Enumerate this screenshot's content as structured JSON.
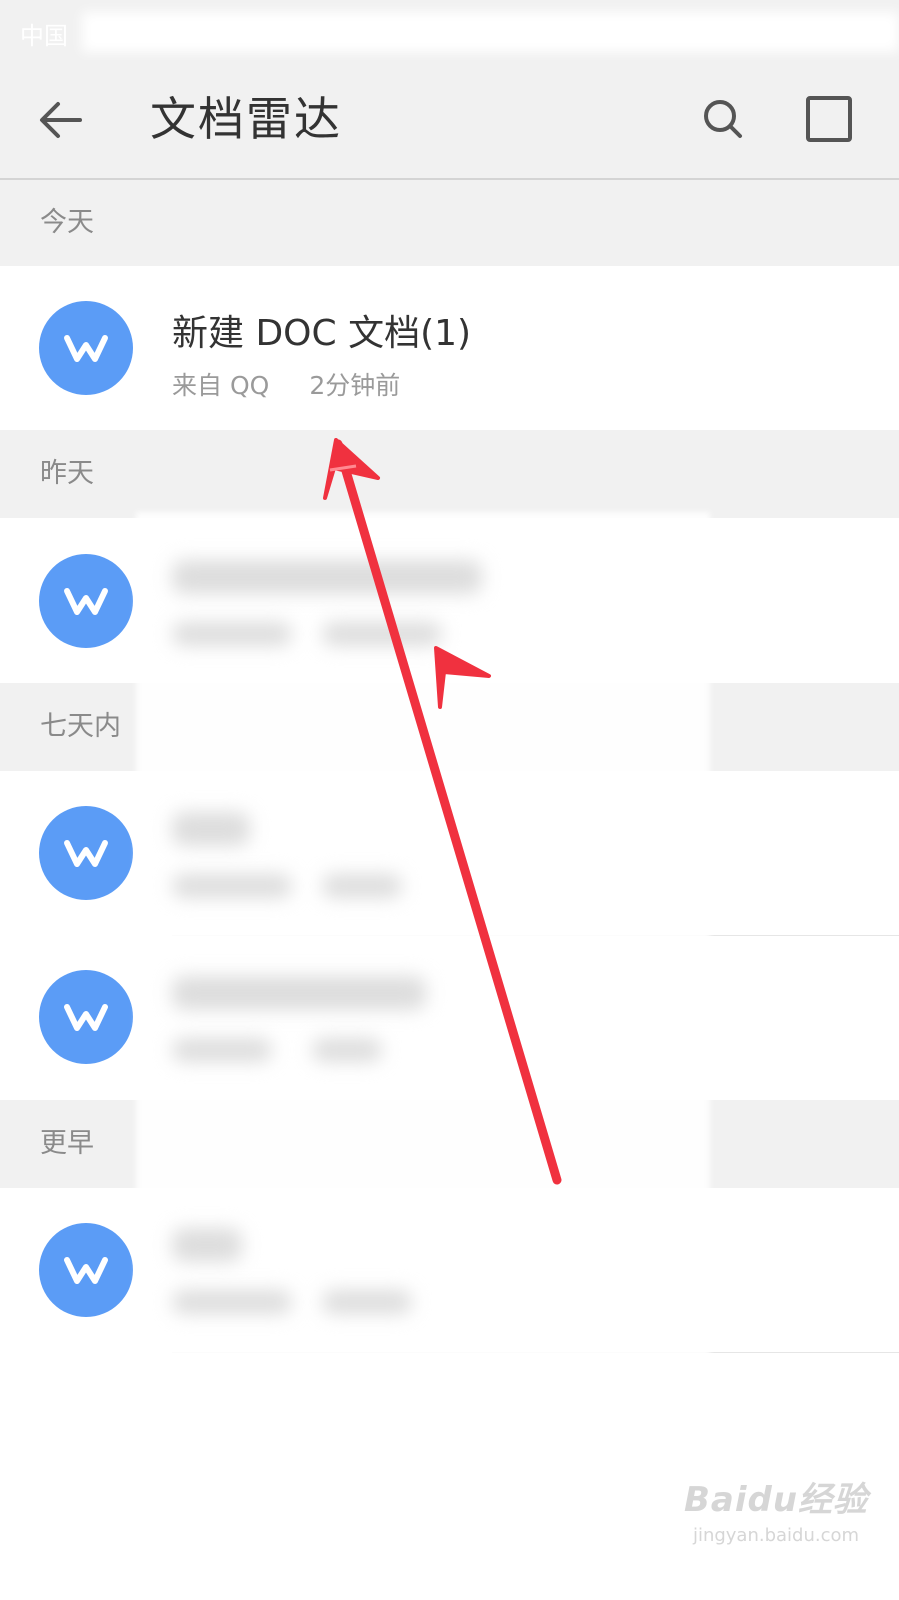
{
  "status_bar": {
    "carrier": "中国"
  },
  "app_bar": {
    "title": "文档雷达",
    "back_icon": "arrow-left-icon",
    "search_icon": "search-icon",
    "select_icon": "square-select-icon"
  },
  "sections": [
    {
      "label": "今天",
      "items": [
        {
          "title": "新建 DOC 文档(1)",
          "source": "来自  QQ",
          "time": "2分钟前",
          "icon": "word-doc-icon"
        }
      ]
    },
    {
      "label": "昨天",
      "items": [
        {
          "icon": "word-doc-icon"
        }
      ]
    },
    {
      "label": "七天内",
      "items": [
        {
          "icon": "word-doc-icon"
        },
        {
          "icon": "word-doc-icon"
        }
      ]
    },
    {
      "label": "更早",
      "items": [
        {
          "icon": "word-doc-icon"
        }
      ]
    }
  ],
  "colors": {
    "accent": "#5b9cf6",
    "annotation_arrow": "#f0313f"
  },
  "watermark": {
    "brand": "Baidu经验",
    "url": "jingyan.baidu.com"
  }
}
